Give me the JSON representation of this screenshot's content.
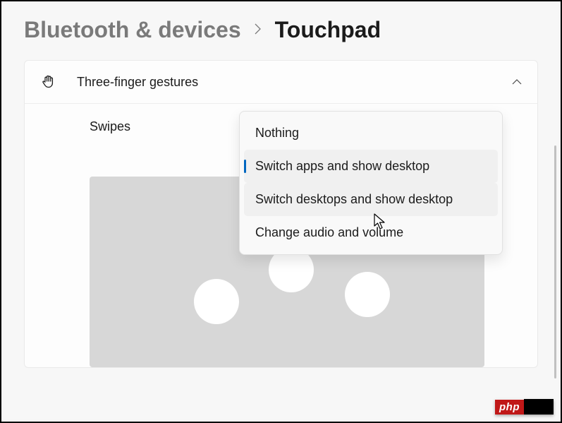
{
  "breadcrumb": {
    "parent": "Bluetooth & devices",
    "current": "Touchpad"
  },
  "section": {
    "title": "Three-finger gestures",
    "swipes_label": "Swipes"
  },
  "dropdown": {
    "options": [
      {
        "label": "Nothing",
        "selected": false,
        "hovered": false
      },
      {
        "label": "Switch apps and show desktop",
        "selected": true,
        "hovered": false
      },
      {
        "label": "Switch desktops and show desktop",
        "selected": false,
        "hovered": true
      },
      {
        "label": "Change audio and volume",
        "selected": false,
        "hovered": false
      }
    ]
  },
  "watermark": {
    "text": "php"
  }
}
